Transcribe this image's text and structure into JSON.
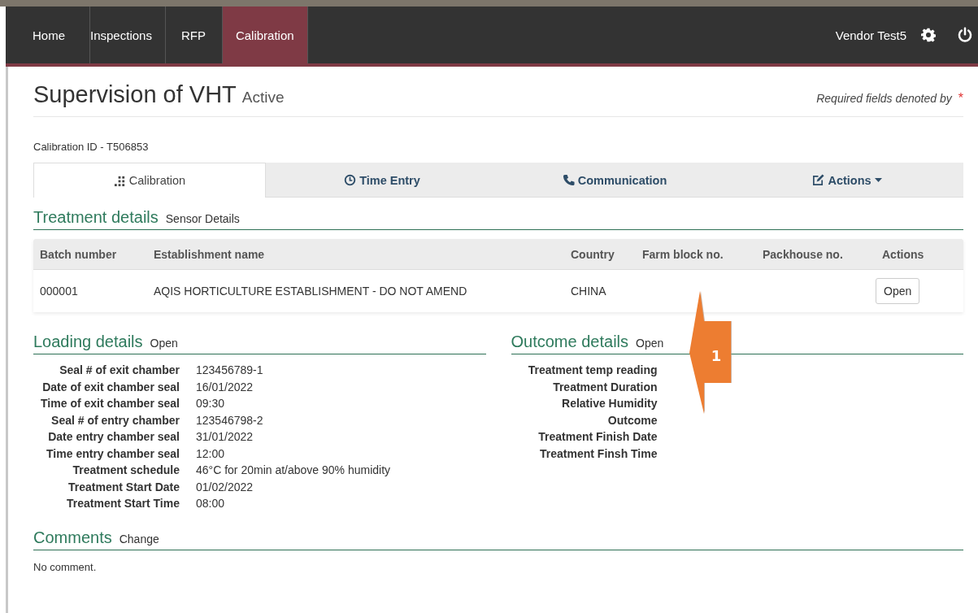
{
  "nav": {
    "items": [
      {
        "label": "Home",
        "selected": false
      },
      {
        "label": "Inspections",
        "selected": false
      },
      {
        "label": "RFP",
        "selected": false
      },
      {
        "label": "Calibration",
        "selected": true
      }
    ],
    "user": "Vendor Test5"
  },
  "header": {
    "title": "Supervision of VHT",
    "status": "Active",
    "required_note": "Required fields denoted by",
    "required_mark": "*"
  },
  "calibration_id": "Calibration ID - T506853",
  "tabs": [
    {
      "label": "Calibration",
      "kind": "tab",
      "selected": true
    },
    {
      "label": "Time Entry",
      "kind": "tab",
      "selected": false
    },
    {
      "label": "Communication",
      "kind": "tab",
      "selected": false
    },
    {
      "label": "Actions",
      "kind": "dropdown",
      "selected": false
    }
  ],
  "treatment": {
    "title": "Treatment details",
    "link": "Sensor Details",
    "columns": [
      "Batch number",
      "Establishment name",
      "Country",
      "Farm block no.",
      "Packhouse no.",
      "Actions"
    ],
    "rows": [
      {
        "cells": [
          "000001",
          "AQIS HORTICULTURE ESTABLISHMENT - DO NOT AMEND",
          "CHINA",
          "",
          ""
        ],
        "action": "Open"
      }
    ]
  },
  "loading": {
    "title": "Loading details",
    "link": "Open",
    "fields": [
      {
        "label": "Seal # of exit chamber",
        "value": "123456789-1"
      },
      {
        "label": "Date of exit chamber seal",
        "value": "16/01/2022"
      },
      {
        "label": "Time of exit chamber seal",
        "value": "09:30"
      },
      {
        "label": "Seal # of entry chamber",
        "value": "123546798-2"
      },
      {
        "label": "Date entry chamber seal",
        "value": "31/01/2022"
      },
      {
        "label": "Time entry chamber seal",
        "value": "12:00"
      },
      {
        "label": "Treatment schedule",
        "value": "46°C for 20min at/above 90% humidity"
      },
      {
        "label": "Treatment Start Date",
        "value": "01/02/2022"
      },
      {
        "label": "Treatment Start Time",
        "value": "08:00"
      }
    ]
  },
  "outcome": {
    "title": "Outcome details",
    "link": "Open",
    "fields": [
      {
        "label": "Treatment temp reading"
      },
      {
        "label": "Treatment Duration"
      },
      {
        "label": "Relative Humidity"
      },
      {
        "label": "Outcome"
      },
      {
        "label": "Treatment Finish Date"
      },
      {
        "label": "Treatment Finsh Time"
      }
    ]
  },
  "comments": {
    "title": "Comments",
    "link": "Change",
    "text": "No comment."
  },
  "callout": {
    "label": "1"
  }
}
